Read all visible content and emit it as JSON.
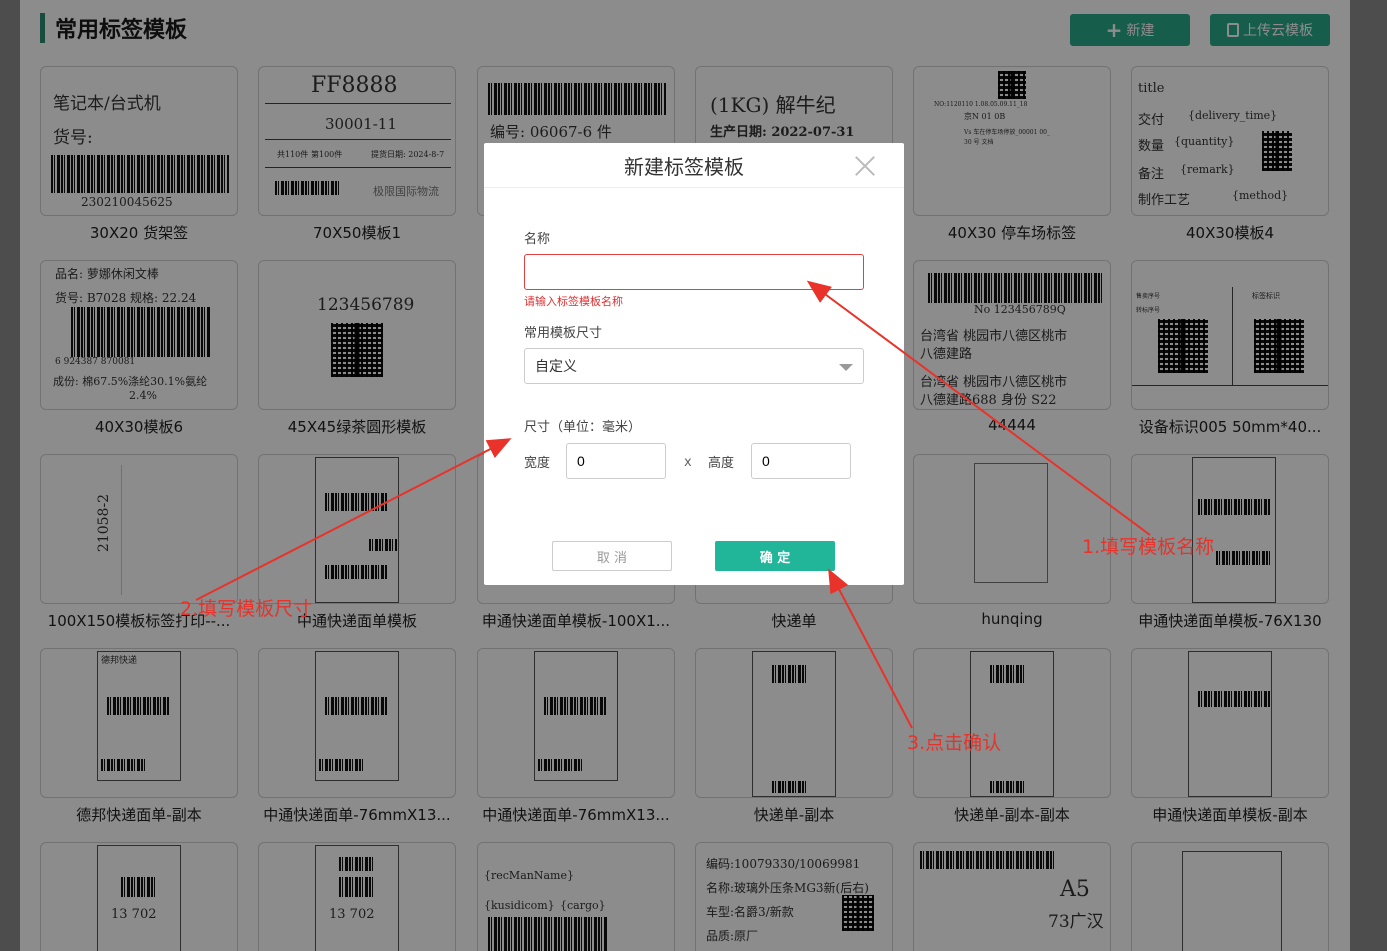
{
  "header": {
    "title": "常用标签模板",
    "new_label": "新建",
    "upload_label": "上传云模板"
  },
  "templates": [
    {
      "label": "30X20 货架签",
      "lines": [
        "笔记本/台式机",
        "货号:",
        "230210045625"
      ]
    },
    {
      "label": "70X50模板1",
      "lines": [
        "FF8888",
        "30001-11",
        "共110件",
        "第100件",
        "提货日期: 2024-8-7",
        "极限国际物流"
      ]
    },
    {
      "label": "",
      "lines": [
        "编号: 06067-6 件"
      ]
    },
    {
      "label": "",
      "lines": [
        "(1KG) 解牛纪",
        "生产日期: 2022-07-31"
      ]
    },
    {
      "label": "40X30 停车场标签",
      "lines": [
        "NO:1120110 1.08.05.09.11_18",
        "京N 01 0B",
        "Vs 车在停车场停放_00001 00_",
        "30 号 文档"
      ]
    },
    {
      "label": "40X30模板4",
      "lines": [
        "title",
        "交付",
        "{delivery_time}",
        "数量",
        "{quantity}",
        "备注",
        "{remark}",
        "制作工艺",
        "{method}"
      ]
    },
    {
      "label": "40X30模板6",
      "lines": [
        "品名: 萝娜休闲文棒",
        "货号: B7028  规格: 22.24",
        "6  924387  870081",
        "成份: 棉67.5%涤纶30.1%氨纶",
        "2.4%"
      ]
    },
    {
      "label": "45X45绿茶圆形模板",
      "lines": [
        "123456789"
      ]
    },
    {
      "label": "44444",
      "lines": [
        "No 123456789Q",
        "台湾省 桃园市八德区桃市",
        "八德建路",
        "台湾省 桃园市八德区桃市",
        "八德建路688 身份 S22"
      ]
    },
    {
      "label": "设备标识005  50mm*40...",
      "lines": [
        "售卖序号",
        "标签标识",
        "转标序号"
      ]
    },
    {
      "label": "100X150模板标签打印--...",
      "lines": [
        "21058-2"
      ]
    },
    {
      "label": "中通快递面单模板",
      "lines": []
    },
    {
      "label": "申通快递面单模板-100X1...",
      "lines": []
    },
    {
      "label": "快递单",
      "lines": []
    },
    {
      "label": "hunqing",
      "lines": []
    },
    {
      "label": "申通快递面单模板-76X130",
      "lines": []
    },
    {
      "label": "德邦快递面单-副本",
      "lines": [
        "德邦快递"
      ]
    },
    {
      "label": "中通快递面单-76mmX13...",
      "lines": []
    },
    {
      "label": "中通快递面单-76mmX13...",
      "lines": []
    },
    {
      "label": "快递单-副本",
      "lines": []
    },
    {
      "label": "快递单-副本-副本",
      "lines": []
    },
    {
      "label": "申通快递面单模板-副本",
      "lines": []
    },
    {
      "label": "",
      "lines": [
        "13 702"
      ]
    },
    {
      "label": "",
      "lines": [
        "13 702"
      ]
    },
    {
      "label": "",
      "lines": [
        "{recManName}",
        "{kusidicom}",
        "{cargo}"
      ]
    },
    {
      "label": "",
      "lines": [
        "编码:10079330/10069981",
        "名称:玻璃外压条MG3新(后右)",
        "车型:名爵3/新款",
        "品质:原厂"
      ]
    },
    {
      "label": "",
      "lines": [
        "A5",
        "73广汉"
      ]
    },
    {
      "label": "",
      "lines": []
    }
  ],
  "modal": {
    "title": "新建标签模板",
    "name_label": "名称",
    "name_value": "",
    "name_error": "请输入标签模板名称",
    "size_select_label": "常用模板尺寸",
    "size_select_value": "自定义",
    "size_label": "尺寸（单位：毫米）",
    "width_label": "宽度",
    "width_value": "0",
    "x_sep": "x",
    "height_label": "高度",
    "height_value": "0",
    "cancel_label": "取 消",
    "ok_label": "确 定"
  },
  "annotations": {
    "step1": "1.填写模板名称",
    "step2": "2.填写模板尺寸",
    "step3": "3.点击确认",
    "color": "#e8322a"
  },
  "colors": {
    "accent": "#2aa98a",
    "ok_button": "#21b59a",
    "error": "#e03030"
  }
}
